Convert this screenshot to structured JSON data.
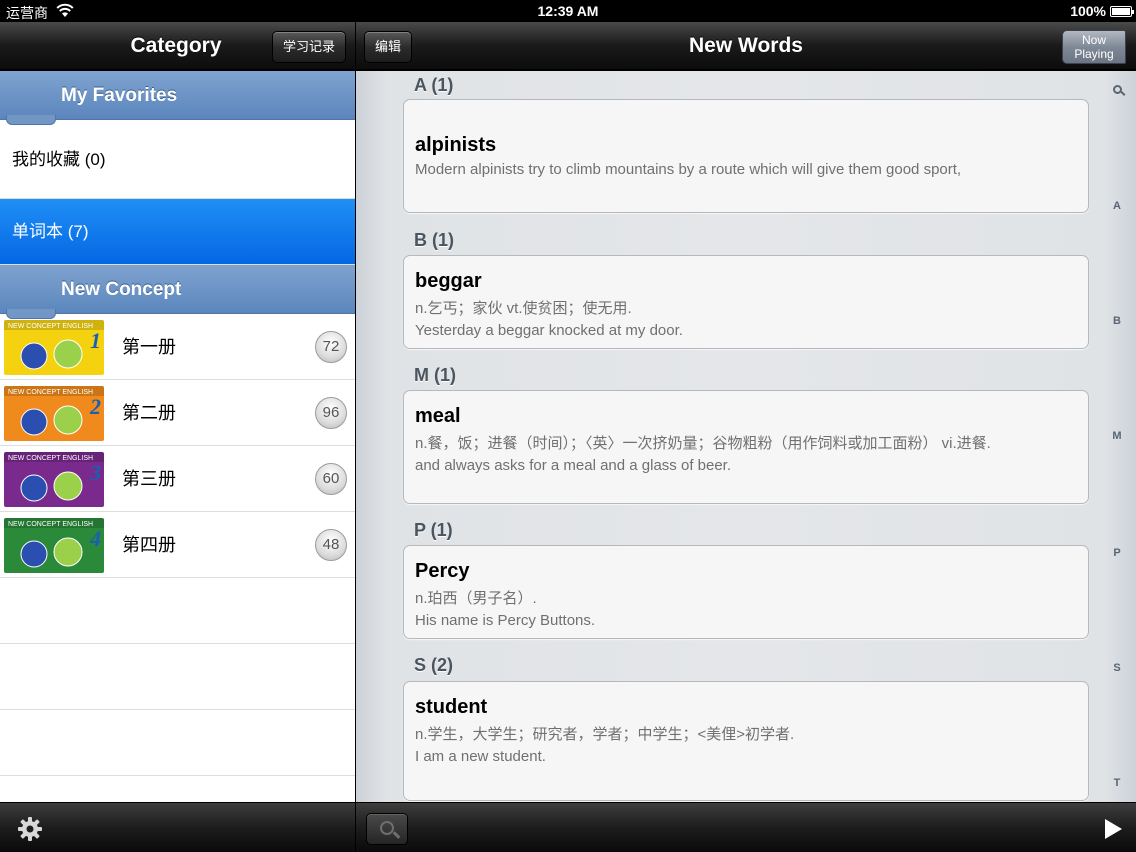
{
  "status_bar": {
    "carrier": "运营商",
    "time": "12:39 AM",
    "battery": "100%"
  },
  "left_nav": {
    "title": "Category",
    "history_button": "学习记录"
  },
  "right_nav": {
    "edit_button": "编辑",
    "title": "New Words",
    "now_playing_line1": "Now",
    "now_playing_line2": "Playing"
  },
  "sidebar": {
    "favorites_header": "My Favorites",
    "favorites_item": "我的收藏 (0)",
    "wordbook_item": "单词本 (7)",
    "concept_header": "New Concept",
    "books": [
      {
        "name": "第一册",
        "count": "72",
        "cover_color": "#f4d210",
        "cover_number": "1"
      },
      {
        "name": "第二册",
        "count": "96",
        "cover_color": "#f08a1c",
        "cover_number": "2"
      },
      {
        "name": "第三册",
        "count": "60",
        "cover_color": "#7a2a8c",
        "cover_number": "3"
      },
      {
        "name": "第四册",
        "count": "48",
        "cover_color": "#2a8a3a",
        "cover_number": "4"
      }
    ],
    "cover_caption": "NEW CONCEPT ENGLISH"
  },
  "groups": [
    {
      "label": "A (1)",
      "entries": [
        {
          "word": "alpinists",
          "lines": [
            "Modern alpinists try to climb mountains by a route which will give them good sport,"
          ]
        }
      ]
    },
    {
      "label": "B (1)",
      "entries": [
        {
          "word": "beggar",
          "lines": [
            "n.乞丐；家伙 vt.使贫困；使无用.",
            "Yesterday a beggar knocked at my door."
          ]
        }
      ]
    },
    {
      "label": "M (1)",
      "entries": [
        {
          "word": "meal",
          "lines": [
            "n.餐，饭；进餐（时间）；〈英〉一次挤奶量；谷物粗粉（用作饲料或加工面粉） vi.进餐.",
            "and always asks for a meal and a glass of beer."
          ]
        }
      ]
    },
    {
      "label": "P (1)",
      "entries": [
        {
          "word": "Percy",
          "lines": [
            "n.珀西（男子名）.",
            "His name is Percy Buttons."
          ]
        }
      ]
    },
    {
      "label": "S (2)",
      "entries": [
        {
          "word": "student",
          "lines": [
            "n.学生，大学生；研究者，学者；中学生；<美俚>初学者.",
            "I am a new student."
          ]
        }
      ]
    }
  ],
  "index_letters": [
    "A",
    "B",
    "M",
    "P",
    "S",
    "T"
  ]
}
